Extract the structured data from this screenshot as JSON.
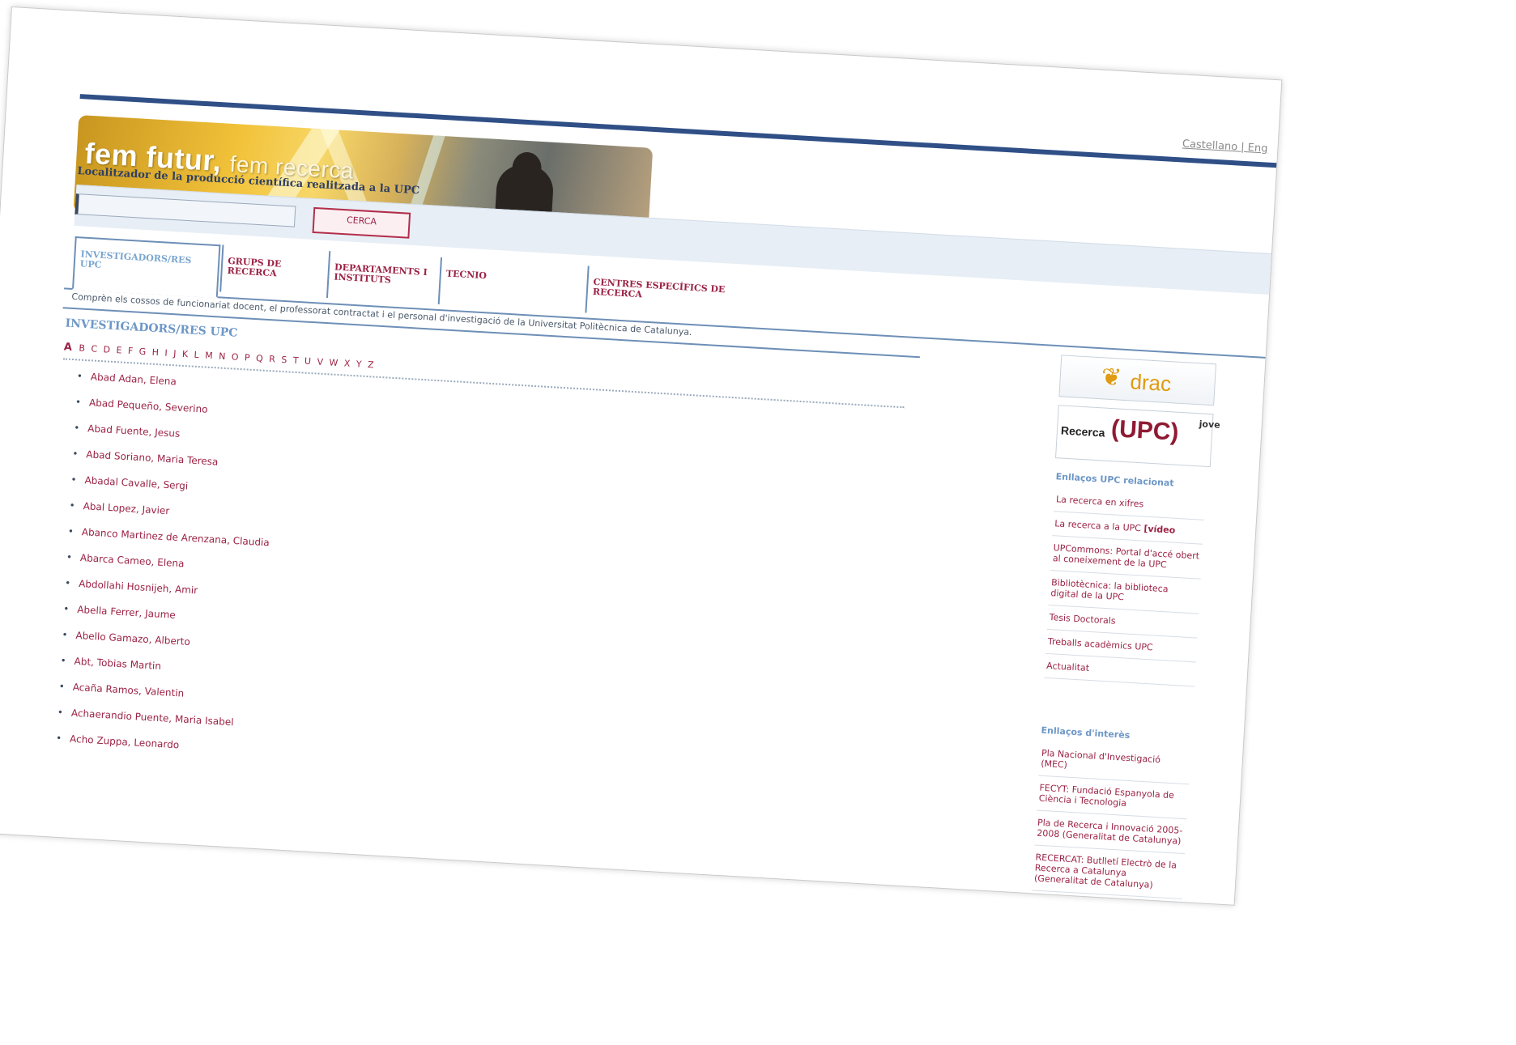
{
  "header": {
    "language_links": "Castellano | Eng",
    "banner_title": "fem futur,",
    "banner_subtitle": "fem recerca",
    "subtitle": "Localitzador de la producció científica realitzada a la UPC"
  },
  "search": {
    "placeholder": "",
    "button_label": "CERCA"
  },
  "tabs": [
    {
      "label": "INVESTIGADORS/RES UPC",
      "active": true
    },
    {
      "label": "GRUPS DE RECERCA",
      "active": false
    },
    {
      "label": "DEPARTAMENTS I INSTITUTS",
      "active": false
    },
    {
      "label": "TECNIO",
      "active": false
    },
    {
      "label": "CENTRES ESPECÍFICS DE RECERCA",
      "active": false
    }
  ],
  "intro_text": "Comprèn els cossos de funcionariat docent, el professorat contractat i el personal d'investigació de la Universitat Politècnica de Catalunya.",
  "panel_title": "INVESTIGADORS/RES UPC",
  "alphabet": {
    "current": "A",
    "letters": "B C D E F G H I J K L M N O P Q R S T U V W X Y Z"
  },
  "researchers": [
    "Abad Adan, Elena",
    "Abad Pequeño, Severino",
    "Abad Fuente, Jesus",
    "Abad Soriano, Maria Teresa",
    "Abadal Cavalle, Sergi",
    "Abal Lopez, Javier",
    "Abanco Martinez de Arenzana, Claudia",
    "Abarca Cameo, Elena",
    "Abdollahi Hosnijeh, Amir",
    "Abella Ferrer, Jaume",
    "Abello Gamazo, Alberto",
    "Abt, Tobias Martin",
    "Acaña Ramos, Valentin",
    "Achaerandio Puente, Maria Isabel",
    "Acho Zuppa, Leonardo"
  ],
  "sidebar": {
    "drac_label": "drac",
    "recerca_text": "Recerca",
    "recerca_upc": "(UPC)",
    "recerca_jove": "jove",
    "related_heading": "Enllaços UPC relacionat",
    "related_links": [
      {
        "text": "La recerca en xifres",
        "extra": ""
      },
      {
        "text": "La recerca a la UPC ",
        "extra": "[vídeo"
      },
      {
        "text": "UPCommons: Portal d'accé obert al coneixement de la UPC",
        "extra": ""
      },
      {
        "text": "Bibliotècnica: la biblioteca digital de la UPC",
        "extra": ""
      },
      {
        "text": "Tesis Doctorals",
        "extra": ""
      },
      {
        "text": "Treballs acadèmics UPC",
        "extra": ""
      },
      {
        "text": "Actualitat",
        "extra": ""
      }
    ],
    "interest_heading": "Enllaços d'interès",
    "interest_links": [
      "Pla Nacional d'Investigació (MEC)",
      "FECYT: Fundació Espanyola de Ciència i Tecnologia",
      "Pla de Recerca i Innovació 2005-2008 (Generalitat de Catalunya)",
      "RECERCAT: Butlletí Electrò de la Recerca a Catalunya (Generalitat de Catalunya)"
    ]
  }
}
